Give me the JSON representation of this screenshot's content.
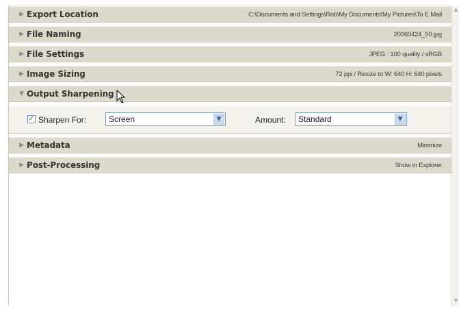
{
  "panels": [
    {
      "title": "Export Location",
      "summary": "C:\\Documents and Settings\\Rob\\My Documents\\My Pictures\\To E Mail",
      "expanded": false
    },
    {
      "title": "File Naming",
      "summary": "20060424_50.jpg",
      "expanded": false
    },
    {
      "title": "File Settings",
      "summary": "JPEG : 100 quality / sRGB",
      "expanded": false
    },
    {
      "title": "Image Sizing",
      "summary": "72 ppi / Resize to W: 640 H: 640 pixels",
      "expanded": false
    },
    {
      "title": "Output Sharpening",
      "summary": "",
      "expanded": true
    },
    {
      "title": "Metadata",
      "summary": "Minimize",
      "expanded": false
    },
    {
      "title": "Post-Processing",
      "summary": "Show in Explorer",
      "expanded": false
    }
  ],
  "sharpening": {
    "checkbox_checked": true,
    "checkbox_label": "Sharpen For:",
    "sharpen_for_value": "Screen",
    "amount_label": "Amount:",
    "amount_value": "Standard"
  },
  "icons": {
    "collapsed": "triangle-right-icon",
    "expanded": "triangle-down-icon",
    "dropdown": "chevron-down-icon",
    "check": "checkmark-icon",
    "cursor": "mouse-pointer-icon"
  },
  "colors": {
    "header_bg": "#dcdacd",
    "content_bg": "#f3f2ed",
    "checkbox_check": "#2e8b2e"
  }
}
